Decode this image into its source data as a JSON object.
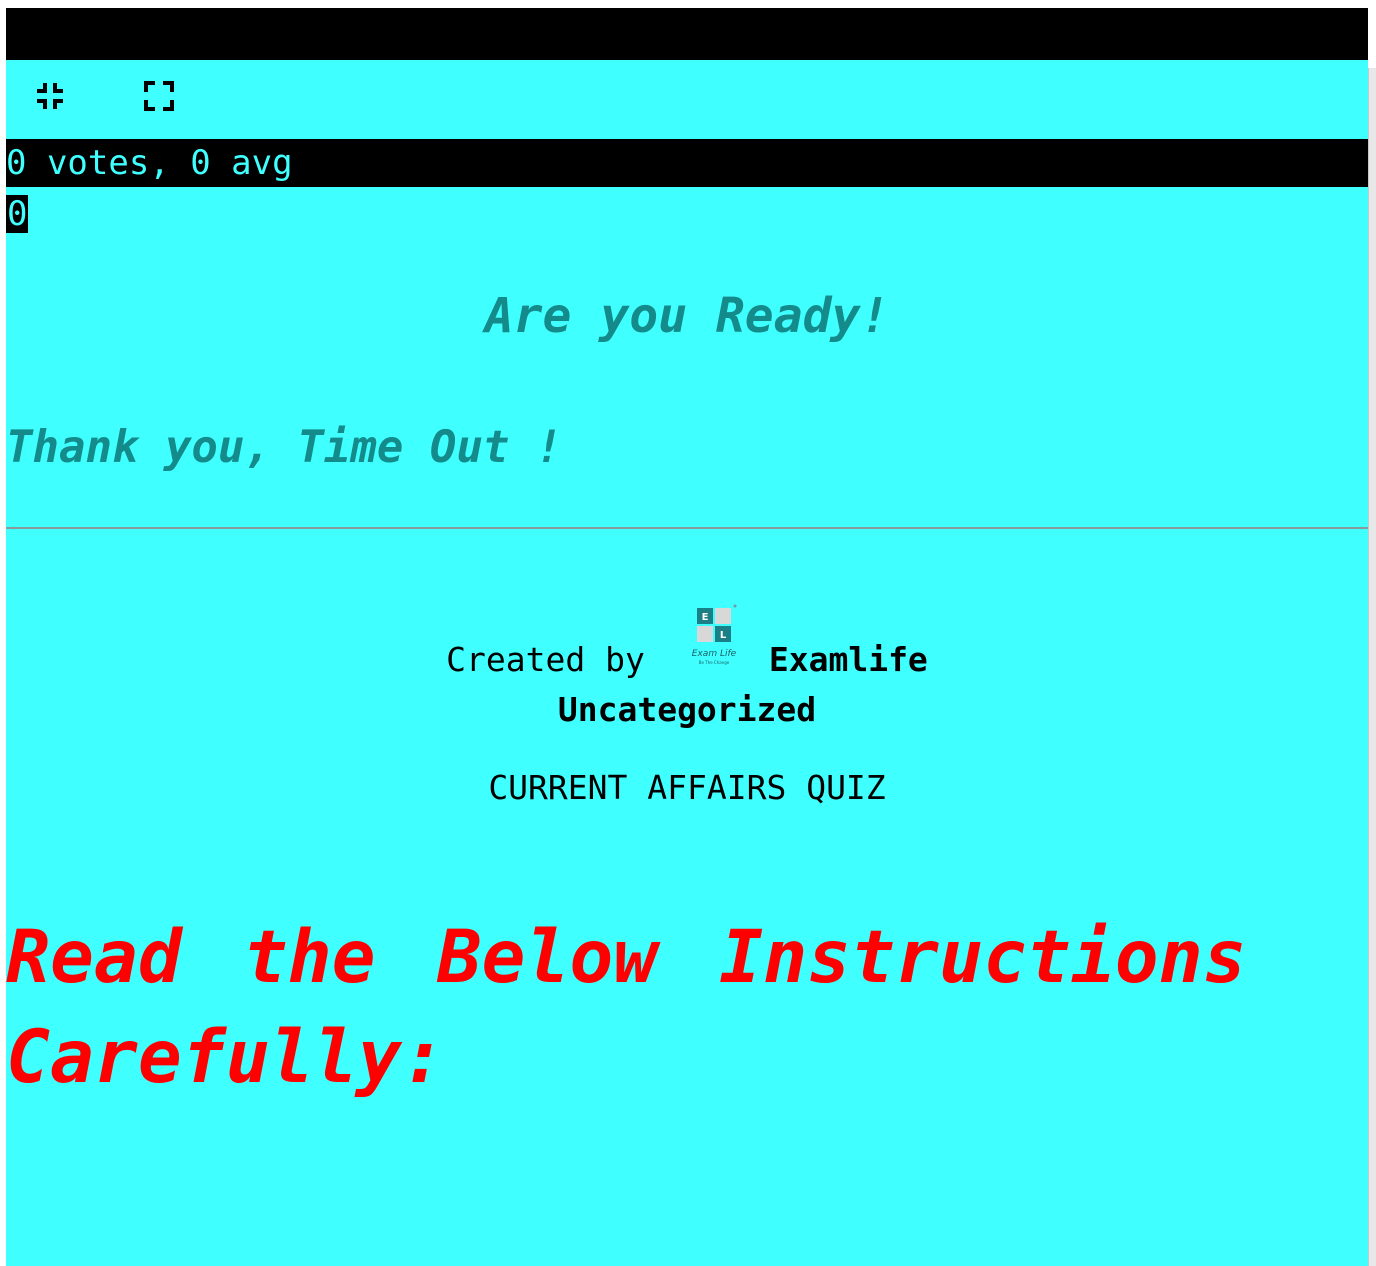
{
  "rating": {
    "summary": "0 votes, 0 avg",
    "count": "0"
  },
  "controls": {
    "exit_fullscreen_icon": "exit-fullscreen-icon",
    "fullscreen_icon": "fullscreen-icon"
  },
  "quiz": {
    "ready_message": "Are you Ready!",
    "timeout_message": "Thank you, Time Out !",
    "created_by_label": "Created by",
    "author": "Examlife",
    "category": "Uncategorized",
    "title": "CURRENT AFFAIRS QUIZ",
    "instructions_heading": "Read the Below Instructions Carefully:"
  },
  "logo": {
    "letters": [
      "E",
      "L"
    ],
    "wordmark": "Exam Life",
    "tagline": "Be The Change"
  },
  "colors": {
    "background": "#3fffff",
    "bar": "#000000",
    "heading_teal": "#148a8a",
    "instructions_red": "#ff0000"
  }
}
